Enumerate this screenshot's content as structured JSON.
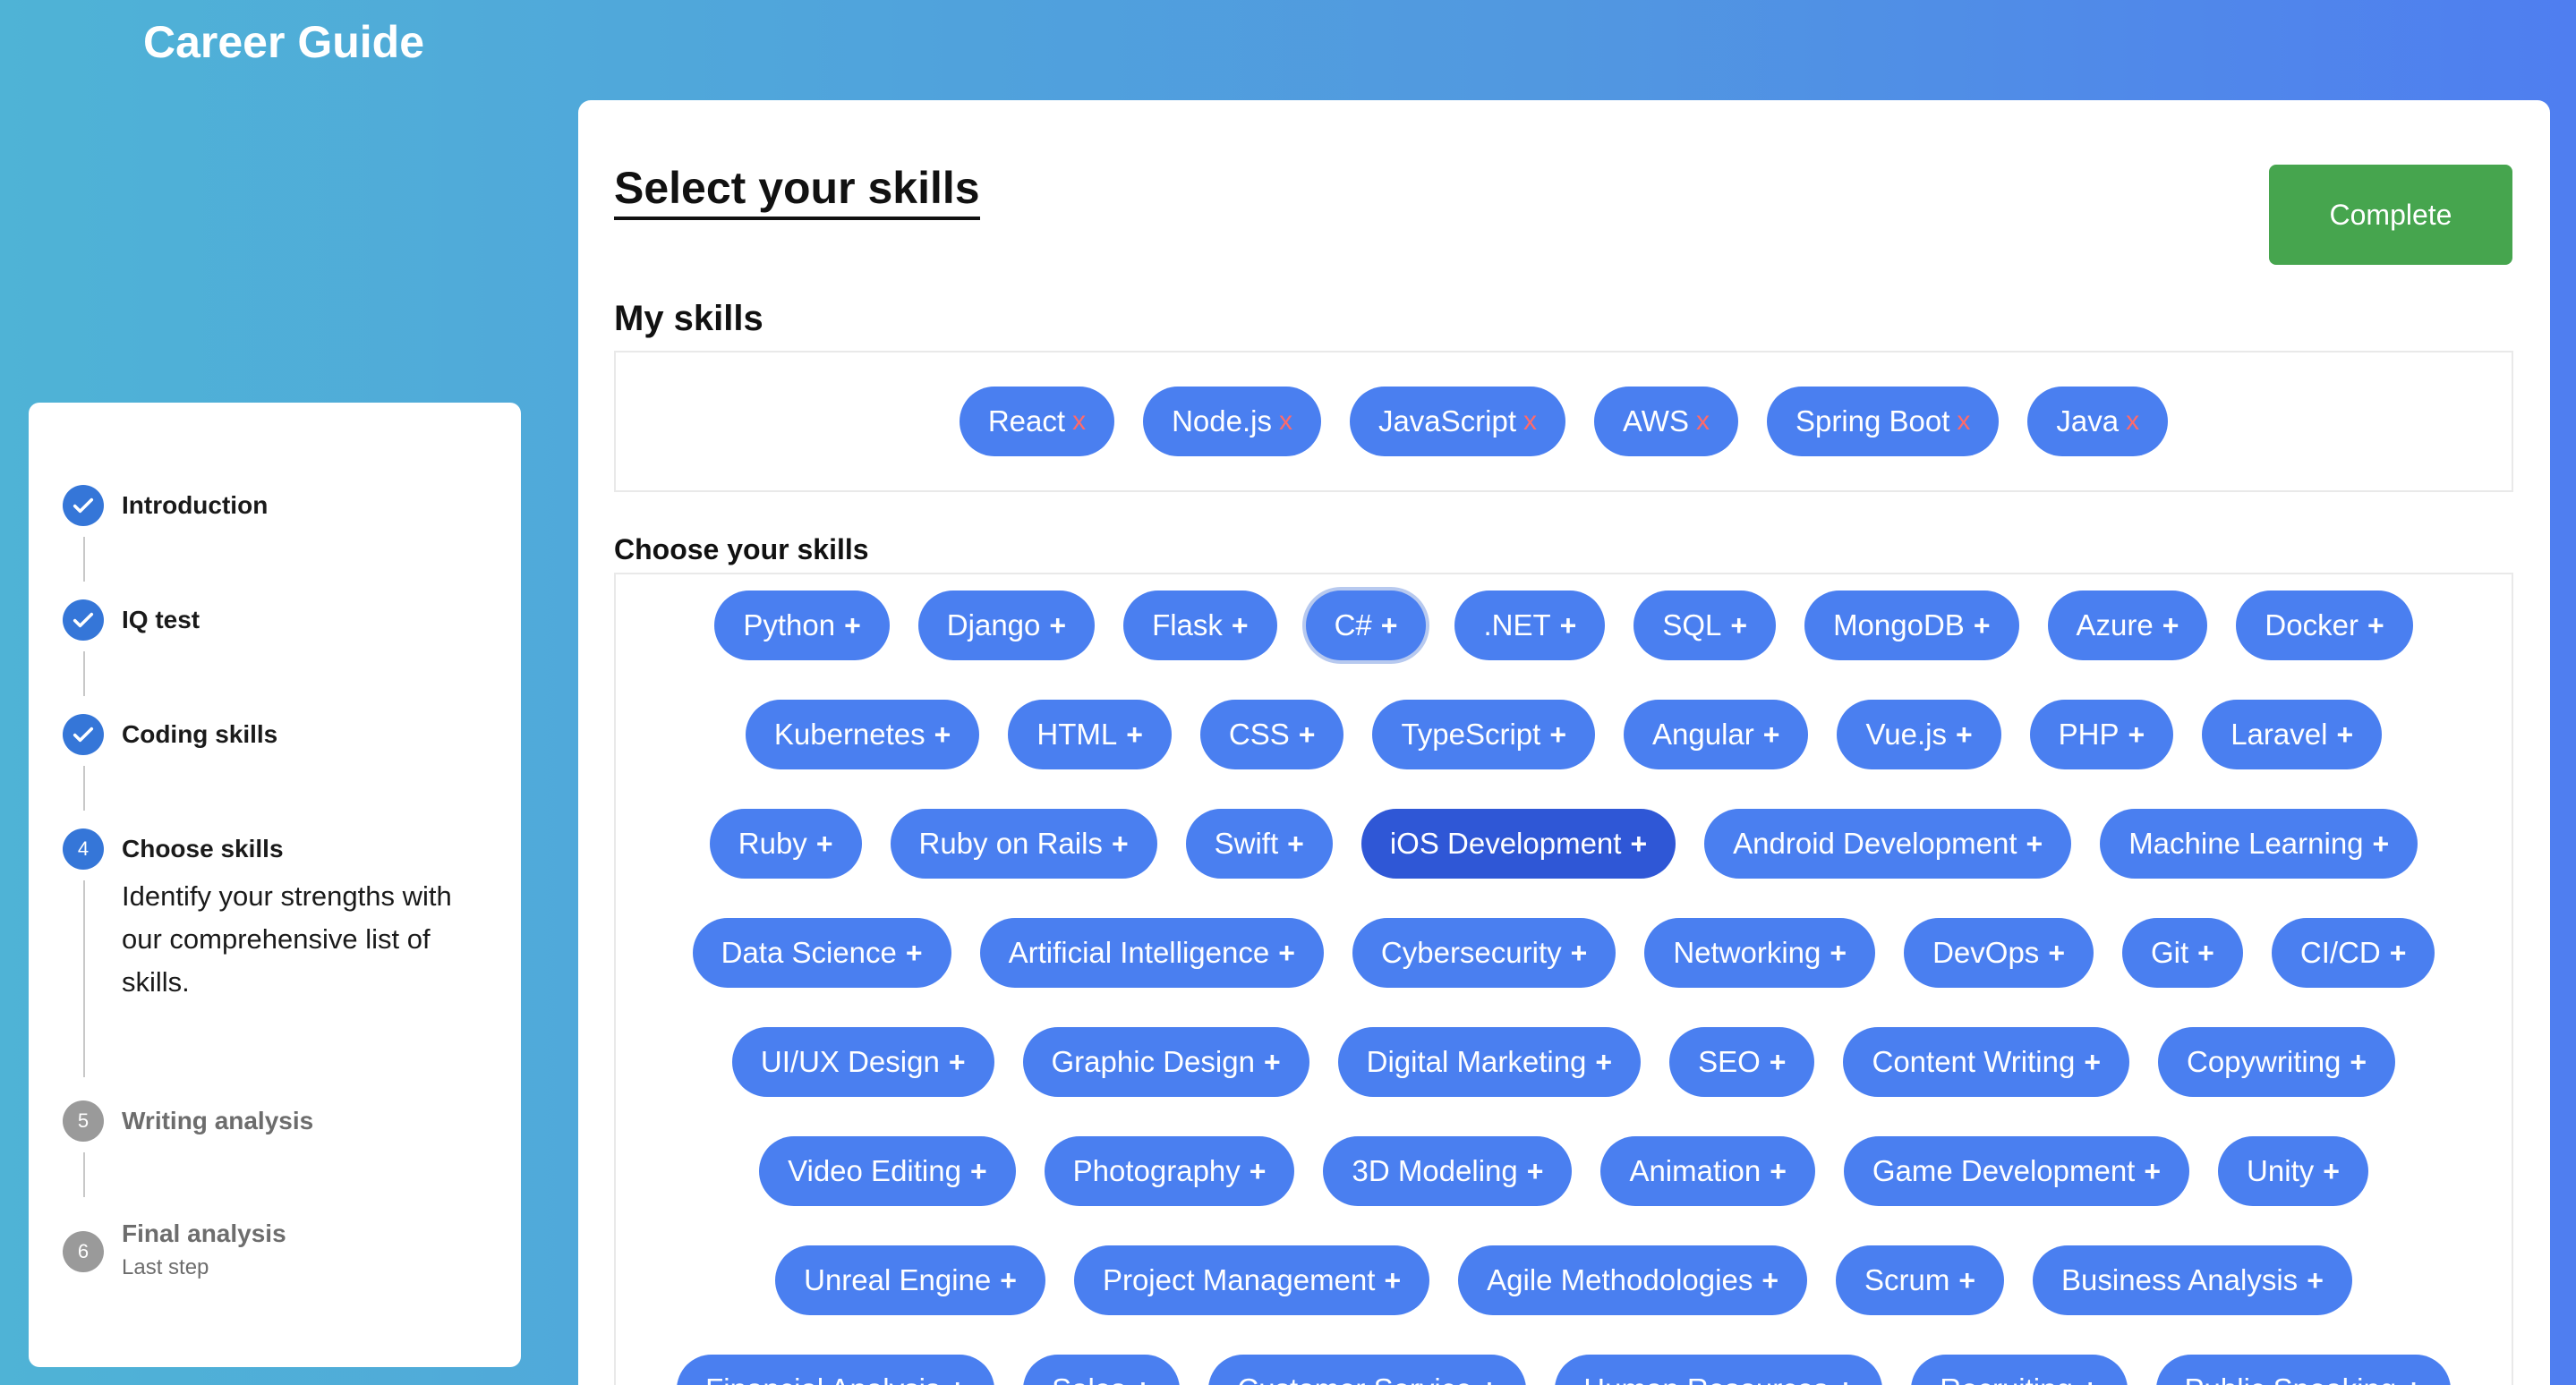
{
  "app": {
    "title": "Career Guide"
  },
  "sidebar": {
    "steps": [
      {
        "label": "Introduction",
        "state": "done"
      },
      {
        "label": "IQ test",
        "state": "done"
      },
      {
        "label": "Coding skills",
        "state": "done"
      },
      {
        "number": "4",
        "label": "Choose skills",
        "state": "active",
        "description": "Identify your strengths with our comprehensive list of skills."
      },
      {
        "number": "5",
        "label": "Writing analysis",
        "state": "pending"
      },
      {
        "number": "6",
        "label": "Final analysis",
        "state": "pending",
        "sub": "Last step"
      }
    ]
  },
  "main": {
    "title": "Select your skills",
    "complete_label": "Complete",
    "my_skills_title": "My skills",
    "choose_title": "Choose your skills",
    "remove_glyph": "x",
    "add_glyph": "+",
    "my_skills": [
      "React",
      "Node.js",
      "JavaScript",
      "AWS",
      "Spring Boot",
      "Java"
    ],
    "available_rows": [
      [
        "Python",
        "Django",
        "Flask",
        "C#",
        ".NET",
        "SQL",
        "MongoDB",
        "Azure",
        "Docker"
      ],
      [
        "Kubernetes",
        "HTML",
        "CSS",
        "TypeScript",
        "Angular",
        "Vue.js",
        "PHP",
        "Laravel"
      ],
      [
        "Ruby",
        "Ruby on Rails",
        "Swift",
        "iOS Development",
        "Android Development",
        "Machine Learning"
      ],
      [
        "Data Science",
        "Artificial Intelligence",
        "Cybersecurity",
        "Networking",
        "DevOps",
        "Git",
        "CI/CD"
      ],
      [
        "UI/UX Design",
        "Graphic Design",
        "Digital Marketing",
        "SEO",
        "Content Writing",
        "Copywriting"
      ],
      [
        "Video Editing",
        "Photography",
        "3D Modeling",
        "Animation",
        "Game Development",
        "Unity"
      ],
      [
        "Unreal Engine",
        "Project Management",
        "Agile Methodologies",
        "Scrum",
        "Business Analysis"
      ],
      [
        "Financial Analysis",
        "Sales",
        "Customer Service",
        "Human Resources",
        "Recruiting",
        "Public Speaking"
      ]
    ],
    "focused_skill": "C#",
    "highlighted_skill": "iOS Development"
  },
  "colors": {
    "chip": "#4a7ff0",
    "chip_selected": "#2f57d6",
    "complete": "#46a54e",
    "step_active": "#3576d8",
    "step_pending": "#9a9a9a",
    "remove": "#ff6a6a"
  },
  "icons": {
    "done_step": "check-icon"
  }
}
